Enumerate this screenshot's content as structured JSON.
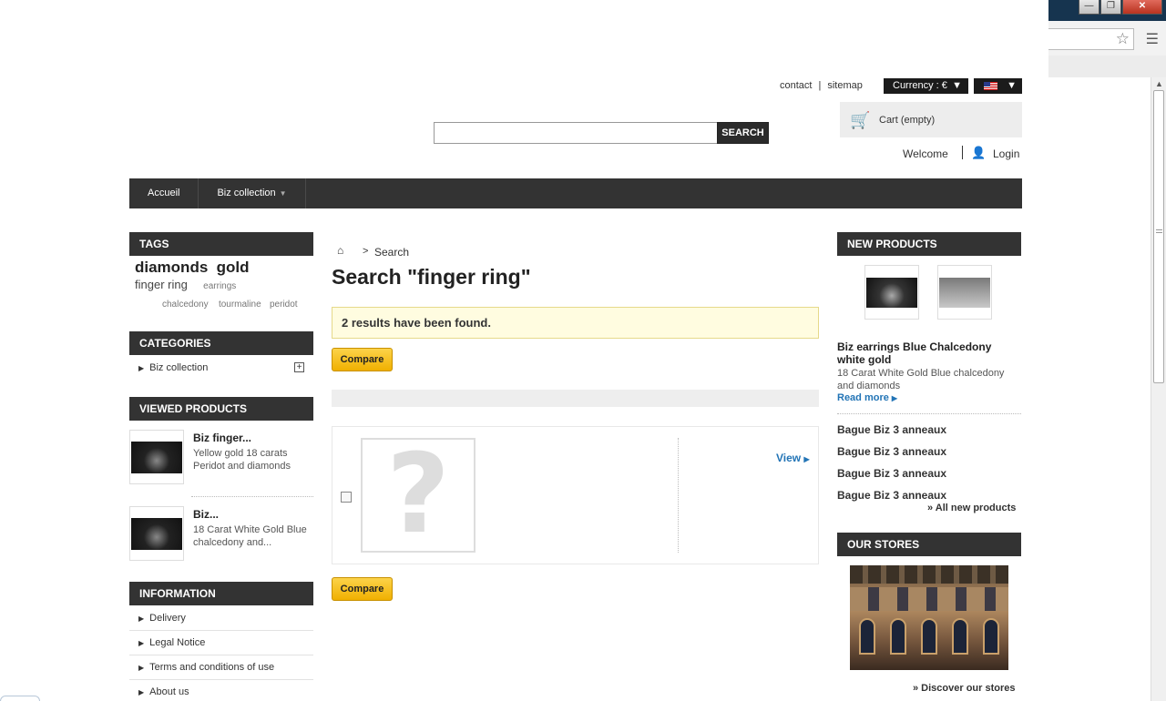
{
  "header": {
    "contact": "contact",
    "separator": "|",
    "sitemap": "sitemap",
    "currency": "Currency : €",
    "dropdown_arrow": "▼",
    "search_button": "SEARCH",
    "search_value": "",
    "cart": "Cart (empty)",
    "welcome": "Welcome",
    "login": "Login"
  },
  "nav": {
    "items": [
      "Accueil",
      "Biz collection"
    ]
  },
  "left": {
    "tags_title": "TAGS",
    "tags": [
      "diamonds",
      "gold",
      "finger ring",
      "earrings",
      "chalcedony",
      "tourmaline",
      "peridot"
    ],
    "categories_title": "CATEGORIES",
    "categories": [
      "Biz collection"
    ],
    "viewed_title": "VIEWED PRODUCTS",
    "viewed": [
      {
        "name": "Biz finger...",
        "desc": "Yellow gold 18 carats Peridot and diamonds"
      },
      {
        "name": "Biz...",
        "desc": "18 Carat White Gold Blue chalcedony and..."
      }
    ],
    "info_title": "INFORMATION",
    "info": [
      "Delivery",
      "Legal Notice",
      "Terms and conditions of use",
      "About us"
    ]
  },
  "main": {
    "breadcrumb_sep": ">",
    "breadcrumb_current": "Search",
    "title": "Search \"finger ring\"",
    "results": "2 results have been found.",
    "compare": "Compare",
    "placeholder_glyph": "?",
    "view": "View"
  },
  "right": {
    "new_title": "NEW PRODUCTS",
    "featured_title": "Biz earrings Blue Chalcedony white gold",
    "featured_desc": "18 Carat White Gold Blue chalcedony and diamonds",
    "read_more": "Read more",
    "items": [
      "Bague Biz 3 anneaux",
      "Bague Biz 3 anneaux",
      "Bague Biz 3 anneaux",
      "Bague Biz 3 anneaux"
    ],
    "all_new": "» All new products",
    "stores_title": "OUR STORES",
    "discover": "» Discover our stores"
  },
  "colors": {
    "dark_bar": "#333333",
    "accent_link": "#2274b6",
    "compare_button": "#f0b000"
  }
}
